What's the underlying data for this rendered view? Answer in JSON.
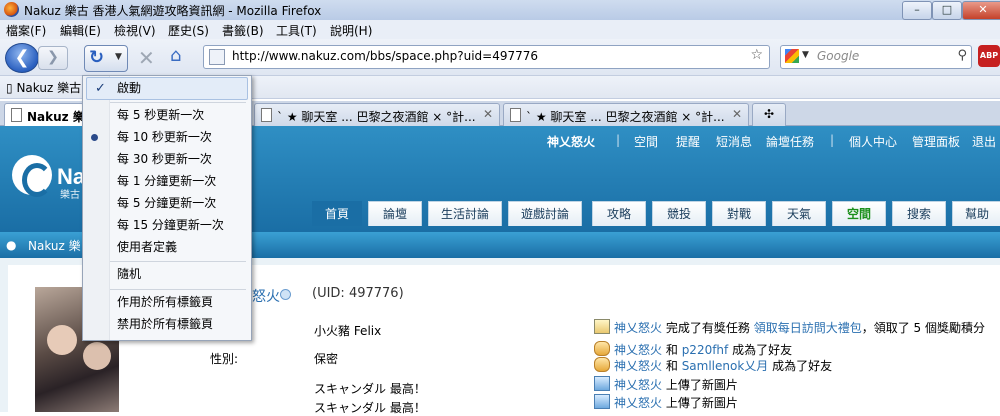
{
  "window": {
    "title": "Nakuz 樂古 香港人氣網遊攻略資訊網 - Mozilla Firefox",
    "controls": [
      "–",
      "□",
      "✕"
    ]
  },
  "menubar": [
    "檔案(F)",
    "編輯(E)",
    "檢視(V)",
    "歷史(S)",
    "書籤(B)",
    "工具(T)",
    "說明(H)"
  ],
  "navigation": {
    "url": "http://www.nakuz.com/bbs/space.php?uid=497776",
    "search_placeholder": "Google",
    "addon_label": "ABP"
  },
  "bookmarks": {
    "item": "Nakuz 樂古"
  },
  "tabs": [
    {
      "title": "Nakuz 樂"
    },
    {
      "title": "` ★ 聊天室 ... 巴黎之夜酒館 × °計..."
    },
    {
      "title": "` ★ 聊天室 ... 巴黎之夜酒館 × °計..."
    }
  ],
  "reload_menu": {
    "items": [
      {
        "label": "啟動",
        "state": "checked"
      },
      {
        "label": "每 5 秒更新一次"
      },
      {
        "label": "每 10 秒更新一次",
        "state": "selected"
      },
      {
        "label": "每 30 秒更新一次"
      },
      {
        "label": "每 1 分鐘更新一次"
      },
      {
        "label": "每 5 分鐘更新一次"
      },
      {
        "label": "每 15 分鐘更新一次"
      },
      {
        "label": "使用者定義"
      },
      {
        "label": "隨机"
      },
      {
        "label": "作用於所有標籤頁"
      },
      {
        "label": "禁用於所有標籤頁"
      }
    ]
  },
  "site": {
    "logo": "Na",
    "logo_sub": "樂古",
    "topnav": [
      "神乂怒火",
      "空間",
      "提醒",
      "短消息",
      "論壇任務",
      "個人中心",
      "管理面板",
      "退出"
    ],
    "mainnav": [
      "首頁",
      "論壇",
      "生活討論",
      "遊戲討論",
      "攻略",
      "競投",
      "對戰",
      "天氣",
      "空間",
      "搜索",
      "幫助"
    ],
    "subbar_title": "Nakuz 樂"
  },
  "profile": {
    "username": "怒火",
    "uid": "(UID: 497776)",
    "realname": "小火豬 Felix",
    "gender_label": "性別:",
    "gender_value": "保密",
    "bio_line1": "スキャンダル 最高！",
    "bio_line2": "スキャンダル 最高！"
  },
  "feed": [
    {
      "user": "神乂怒火",
      "text1": "完成了有獎任務",
      "link": "領取每日訪問大禮包",
      "text2": "，領取了 5 個獎勵積分"
    },
    {
      "user": "神乂怒火",
      "text1": "和",
      "link": "p220fhf",
      "text2": "成為了好友"
    },
    {
      "user": "神乂怒火",
      "text1": "和",
      "link": "Samllenok乂月",
      "text2": "成為了好友"
    },
    {
      "user": "神乂怒火",
      "text1": "上傳了新圖片",
      "link": "",
      "text2": ""
    },
    {
      "user": "神乂怒火",
      "text1": "上傳了新圖片",
      "link": "",
      "text2": ""
    }
  ],
  "colors": {
    "header_blue": "#1a6ea5",
    "link_blue": "#2a6fb0",
    "menu_highlight": "#e3ecf8"
  }
}
